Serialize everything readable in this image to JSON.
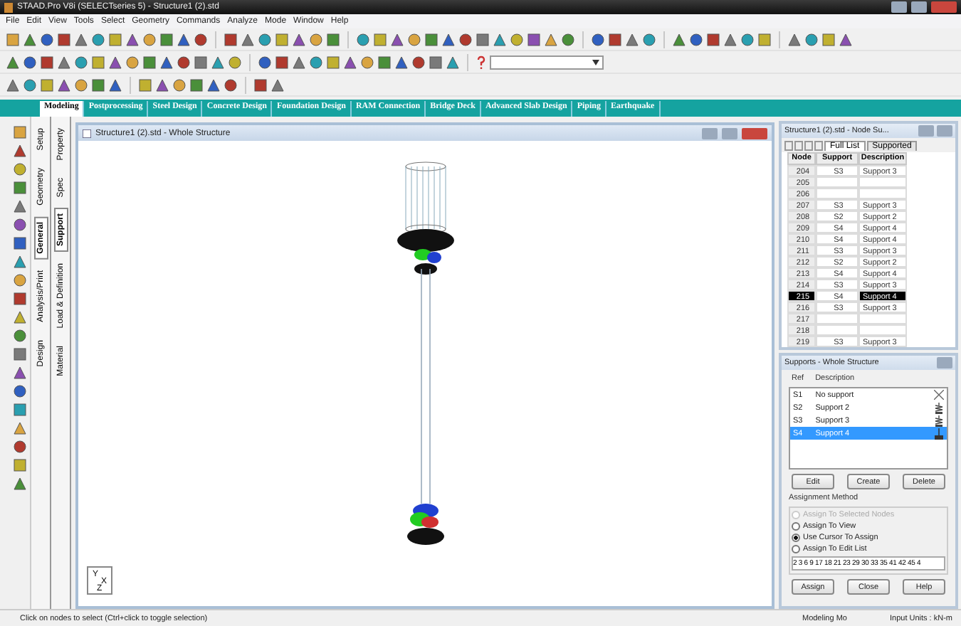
{
  "window": {
    "title": "STAAD.Pro V8i (SELECTseries 5) - Structure1 (2).std"
  },
  "menu": [
    "File",
    "Edit",
    "View",
    "Tools",
    "Select",
    "Geometry",
    "Commands",
    "Analyze",
    "Mode",
    "Window",
    "Help"
  ],
  "ribbon_tabs": [
    {
      "label": "Modeling",
      "selected": true
    },
    {
      "label": "Postprocessing",
      "selected": false
    },
    {
      "label": "Steel Design",
      "selected": false
    },
    {
      "label": "Concrete Design",
      "selected": false
    },
    {
      "label": "Foundation Design",
      "selected": false
    },
    {
      "label": "RAM Connection",
      "selected": false
    },
    {
      "label": "Bridge Deck",
      "selected": false
    },
    {
      "label": "Advanced Slab Design",
      "selected": false
    },
    {
      "label": "Piping",
      "selected": false
    },
    {
      "label": "Earthquake",
      "selected": false
    }
  ],
  "side_tabs_outer": [
    {
      "label": "Setup",
      "selected": false
    },
    {
      "label": "Geometry",
      "selected": false
    },
    {
      "label": "General",
      "selected": true
    },
    {
      "label": "Analysis/Print",
      "selected": false
    },
    {
      "label": "Design",
      "selected": false
    }
  ],
  "side_tabs_inner": [
    {
      "label": "Property",
      "selected": false
    },
    {
      "label": "Spec",
      "selected": false
    },
    {
      "label": "Support",
      "selected": true
    },
    {
      "label": "Load & Definition",
      "selected": false
    },
    {
      "label": "Material",
      "selected": false
    }
  ],
  "viewport": {
    "title": "Structure1 (2).std - Whole Structure",
    "axis_labels": [
      "Y",
      "X",
      "Z"
    ]
  },
  "node_table": {
    "title": "Structure1 (2).std - Node Su...",
    "tabs": [
      {
        "label": "Full List",
        "selected": true
      },
      {
        "label": "Supported",
        "selected": false
      }
    ],
    "columns": [
      "Node",
      "Support",
      "Description"
    ],
    "rows": [
      {
        "node": "204",
        "support": "S3",
        "description": "Support 3",
        "selected": false
      },
      {
        "node": "205",
        "selected": false
      },
      {
        "node": "206",
        "selected": false
      },
      {
        "node": "207",
        "support": "S3",
        "description": "Support 3",
        "selected": false
      },
      {
        "node": "208",
        "support": "S2",
        "description": "Support 2",
        "selected": false
      },
      {
        "node": "209",
        "support": "S4",
        "description": "Support 4",
        "selected": false
      },
      {
        "node": "210",
        "support": "S4",
        "description": "Support 4",
        "selected": false
      },
      {
        "node": "211",
        "support": "S3",
        "description": "Support 3",
        "selected": false
      },
      {
        "node": "212",
        "support": "S2",
        "description": "Support 2",
        "selected": false
      },
      {
        "node": "213",
        "support": "S4",
        "description": "Support 4",
        "selected": false
      },
      {
        "node": "214",
        "support": "S3",
        "description": "Support 3",
        "selected": false
      },
      {
        "node": "215",
        "support": "S4",
        "description": "Support 4",
        "selected": true
      },
      {
        "node": "216",
        "support": "S3",
        "description": "Support 3",
        "selected": false
      },
      {
        "node": "217",
        "selected": false
      },
      {
        "node": "218",
        "selected": false
      },
      {
        "node": "219",
        "support": "S3",
        "description": "Support 3",
        "selected": false
      }
    ]
  },
  "supports_dialog": {
    "title": "Supports - Whole Structure",
    "columns": [
      "Ref",
      "Description"
    ],
    "items": [
      {
        "ref": "S1",
        "description": "No support",
        "kind": "none",
        "selected": false
      },
      {
        "ref": "S2",
        "description": "Support 2",
        "kind": "spring",
        "selected": false
      },
      {
        "ref": "S3",
        "description": "Support 3",
        "kind": "spring",
        "selected": false
      },
      {
        "ref": "S4",
        "description": "Support 4",
        "kind": "fixed",
        "selected": true
      }
    ],
    "buttons": [
      "Edit",
      "Create",
      "Delete"
    ],
    "group_title": "Assignment Method",
    "methods": [
      {
        "label": "Assign To Selected Nodes",
        "selected": false,
        "disabled": true
      },
      {
        "label": "Assign To View",
        "selected": false,
        "disabled": false
      },
      {
        "label": "Use Cursor To Assign",
        "selected": true,
        "disabled": false
      },
      {
        "label": "Assign To Edit List",
        "selected": false,
        "disabled": false
      }
    ],
    "edit_list": {
      "value": "2 3 6 9 17 18 21 23 29 30 33 35 41 42 45 4"
    },
    "bottom_buttons": [
      "Assign",
      "Close",
      "Help"
    ]
  },
  "status_bar": {
    "message": "Click on nodes to select (Ctrl+click to toggle selection)",
    "mode": "Modeling Mo",
    "units": "Input Units : kN-m"
  }
}
